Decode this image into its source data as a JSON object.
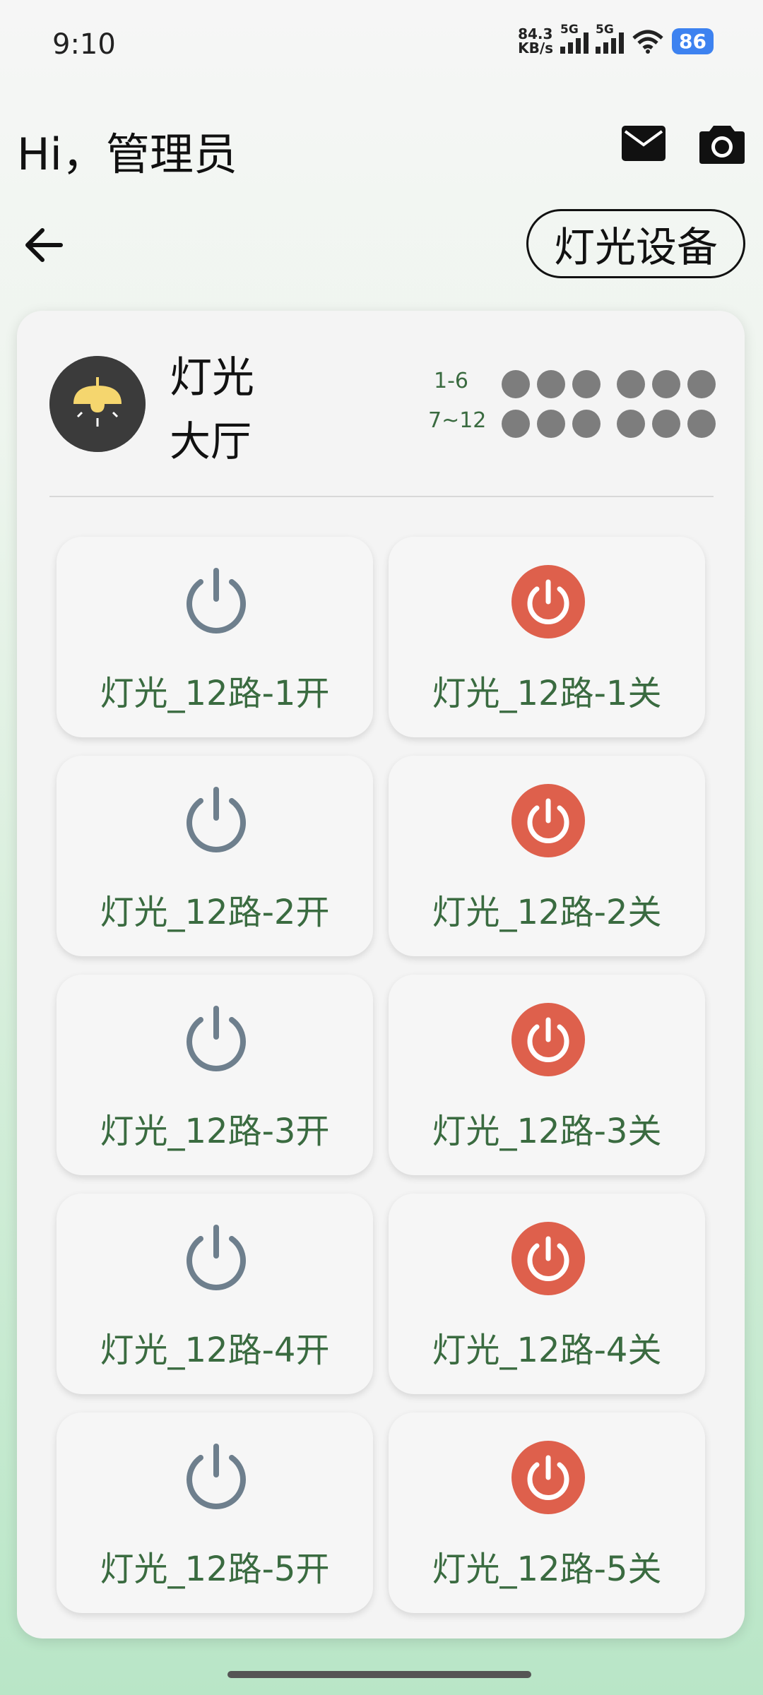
{
  "status_bar": {
    "time": "9:10",
    "net_speed_value": "84.3",
    "net_speed_unit": "KB/s",
    "sim1_label": "5G",
    "sim2_label": "5G",
    "battery": "86"
  },
  "header": {
    "greeting": "Hi，管理员",
    "mail_icon": "mail-icon",
    "camera_icon": "camera-icon"
  },
  "nav": {
    "back_icon": "back-arrow-icon",
    "device_type": "灯光设备"
  },
  "device": {
    "icon": "lamp-icon",
    "name": "灯光",
    "room": "大厅",
    "range_1": "1-6",
    "range_2": "7~12",
    "channel_status_color": "#7d7d7d"
  },
  "switches": [
    {
      "label": "灯光_12路-1开",
      "type": "on"
    },
    {
      "label": "灯光_12路-1关",
      "type": "off"
    },
    {
      "label": "灯光_12路-2开",
      "type": "on"
    },
    {
      "label": "灯光_12路-2关",
      "type": "off"
    },
    {
      "label": "灯光_12路-3开",
      "type": "on"
    },
    {
      "label": "灯光_12路-3关",
      "type": "off"
    },
    {
      "label": "灯光_12路-4开",
      "type": "on"
    },
    {
      "label": "灯光_12路-4关",
      "type": "off"
    },
    {
      "label": "灯光_12路-5开",
      "type": "on"
    },
    {
      "label": "灯光_12路-5关",
      "type": "off"
    }
  ],
  "colors": {
    "on_icon": "#6e7f8d",
    "off_icon_bg": "#de604c",
    "label_text": "#3a6b40"
  }
}
